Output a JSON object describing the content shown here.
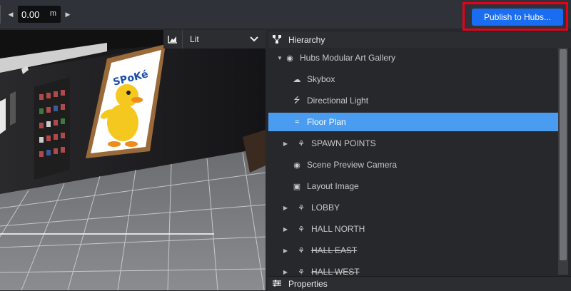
{
  "toolbar": {
    "grid_value": "0.00",
    "grid_unit": "m",
    "publish_label": "Publish to Hubs..."
  },
  "viewport": {
    "render_mode": "Lit",
    "poster_text": "SPoKé"
  },
  "hierarchy": {
    "title": "Hierarchy",
    "items": [
      {
        "label": "Hubs Modular Art Gallery",
        "icon": "globe-icon"
      },
      {
        "label": "Skybox",
        "icon": "cloud-icon"
      },
      {
        "label": "Directional Light",
        "icon": "bolt-icon"
      },
      {
        "label": "Floor Plan",
        "icon": "floor-plan-icon",
        "selected": true
      },
      {
        "label": "SPAWN POINTS",
        "icon": "group-icon"
      },
      {
        "label": "Scene Preview Camera",
        "icon": "camera-icon"
      },
      {
        "label": "Layout Image",
        "icon": "cube-icon"
      },
      {
        "label": "LOBBY",
        "icon": "group-icon"
      },
      {
        "label": "HALL NORTH",
        "icon": "group-icon"
      },
      {
        "label": "HALL EAST",
        "icon": "group-icon",
        "disabled": true
      },
      {
        "label": "HALL WEST",
        "icon": "group-icon",
        "disabled": true
      }
    ]
  },
  "properties": {
    "title": "Properties"
  },
  "colors": {
    "accent": "#1a6df0",
    "selection": "#4a9cf0",
    "highlight_border": "#e8001a"
  }
}
